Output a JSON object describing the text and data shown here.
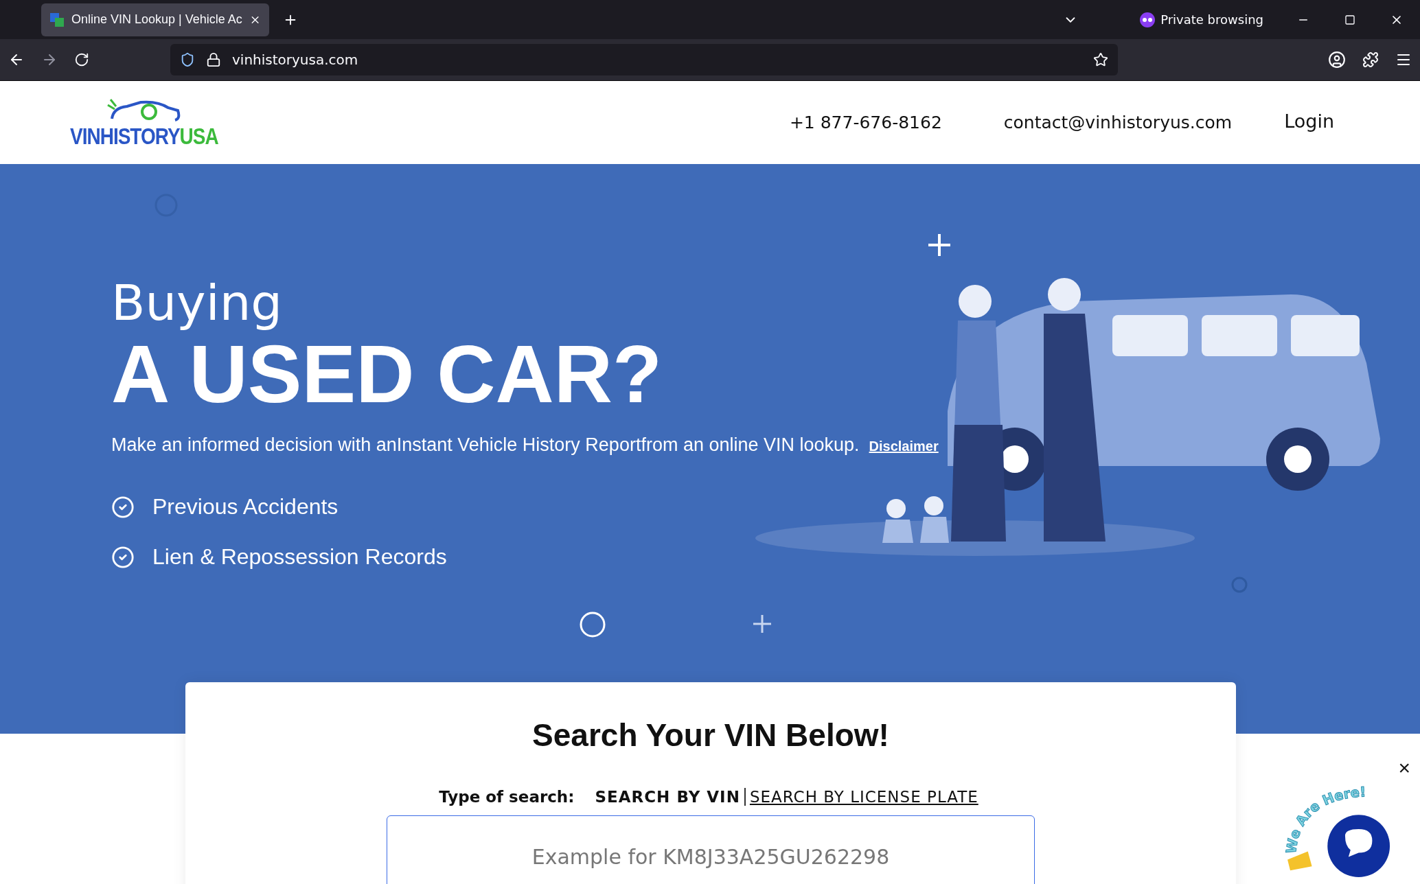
{
  "browser": {
    "tabs": [
      {
        "title": "Online VIN Lookup | Vehicle Ac",
        "selected": true
      }
    ],
    "private_label": "Private browsing",
    "url": "vinhistoryusa.com"
  },
  "header": {
    "logo_text": {
      "first": "VIN",
      "second": "HISTORY",
      "third": "USA"
    },
    "phone": "+1 877-676-8162",
    "email": "contact@vinhistoryus.com",
    "login": "Login"
  },
  "hero": {
    "kicker": "Buying",
    "headline": "A USED CAR?",
    "subtitle": "Make an informed decision with anInstant Vehicle History Reportfrom an online VIN lookup.",
    "disclaimer": "Disclaimer",
    "features": [
      {
        "label": "Previous Accidents",
        "checked": true
      },
      {
        "label": "Lien & Repossession Records",
        "checked": true
      }
    ]
  },
  "search": {
    "title": "Search Your VIN Below!",
    "type_label": "Type of search:",
    "options": [
      {
        "label": "SEARCH BY VIN",
        "selected": true
      },
      {
        "label": "SEARCH BY LICENSE PLATE",
        "selected": false
      }
    ],
    "placeholder": "Example for KM8J33A25GU262298"
  },
  "chat": {
    "banner": "We Are Here!",
    "close": "×"
  }
}
